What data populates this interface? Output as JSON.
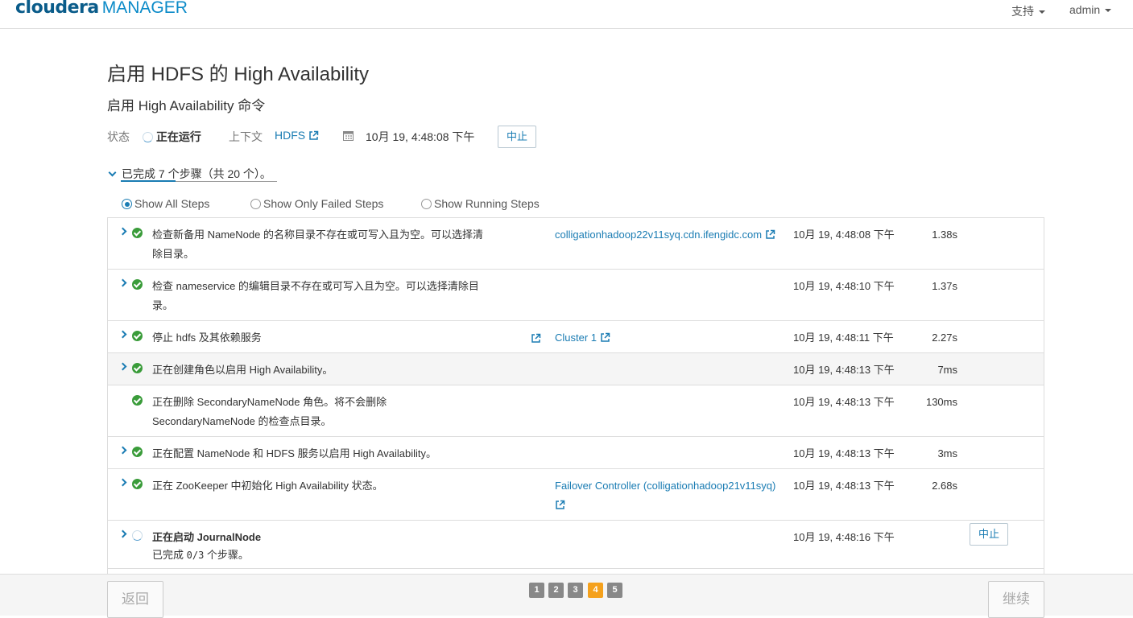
{
  "header": {
    "brand": "cloudera",
    "product": "MANAGER",
    "support_menu": "支持",
    "user_menu": "admin"
  },
  "page": {
    "title": "启用 HDFS 的 High Availability",
    "command_title": "启用 High Availability 命令"
  },
  "meta": {
    "status_label": "状态",
    "status_value": "正在运行",
    "context_label": "上下文",
    "context_value": "HDFS",
    "date": "10月 19, 4:48:08 下午",
    "abort_label": "中止"
  },
  "summary": {
    "text": "已完成 7 个步骤（共 20 个）。"
  },
  "filters": [
    {
      "label": "Show All Steps",
      "checked": true
    },
    {
      "label": "Show Only Failed Steps",
      "checked": false
    },
    {
      "label": "Show Running Steps",
      "checked": false
    }
  ],
  "steps": [
    {
      "desc": "检查新备用 NameNode 的名称目录不存在或可写入且为空。可以选择清除目录。",
      "context": "colligationhadoop22v11syq.cdn.ifengidc.com",
      "time": "10月 19, 4:48:08 下午",
      "duration": "1.38s",
      "status": "success"
    },
    {
      "desc": "检查 nameservice 的编辑目录不存在或可写入且为空。可以选择清除目录。",
      "context": "",
      "time": "10月 19, 4:48:10 下午",
      "duration": "1.37s",
      "status": "success"
    },
    {
      "desc": "停止 hdfs 及其依赖服务",
      "context": "Cluster 1",
      "time": "10月 19, 4:48:11 下午",
      "duration": "2.27s",
      "status": "success"
    },
    {
      "desc": "正在创建角色以启用 High Availability。",
      "context": "",
      "time": "10月 19, 4:48:13 下午",
      "duration": "7ms",
      "status": "success"
    },
    {
      "desc": "正在删除 SecondaryNameNode 角色。将不会删除 SecondaryNameNode 的检查点目录。",
      "context": "",
      "time": "10月 19, 4:48:13 下午",
      "duration": "130ms",
      "status": "success"
    },
    {
      "desc": "正在配置 NameNode 和 HDFS 服务以启用 High Availability。",
      "context": "",
      "time": "10月 19, 4:48:13 下午",
      "duration": "3ms",
      "status": "success"
    },
    {
      "desc": "正在 ZooKeeper 中初始化 High Availability 状态。",
      "context": "Failover Controller (colligationhadoop21v11syq)",
      "time": "10月 19, 4:48:13 下午",
      "duration": "2.68s",
      "status": "success"
    },
    {
      "desc": "正在启动 JournalNode",
      "sub_prefix": "已完成 ",
      "sub_count": "0/3",
      "sub_suffix": " 个步骤。",
      "context": "",
      "time": "10月 19, 4:48:16 下午",
      "duration": "",
      "status": "running",
      "abort_label": "中止"
    }
  ],
  "footer": {
    "back_label": "返回",
    "continue_label": "继续",
    "pages": [
      "1",
      "2",
      "3",
      "4",
      "5"
    ],
    "current_page": "4"
  },
  "colors": {
    "accent": "#1a7cb3",
    "success": "#3a9c3a",
    "pager_active": "#f5a11c",
    "pager": "#888888"
  }
}
